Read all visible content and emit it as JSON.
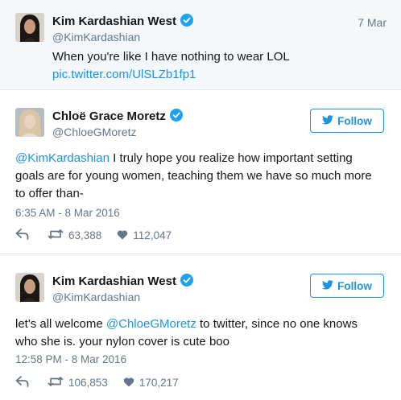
{
  "tweet1": {
    "name": "Kim Kardashian West",
    "handle": "@KimKardashian",
    "date": "7 Mar",
    "text": "When you're like I have nothing to wear LOL",
    "link": "pic.twitter.com/UlSLZb1fp1"
  },
  "tweet2": {
    "name": "Chloë Grace Moretz",
    "handle": "@ChloeGMoretz",
    "follow_label": "Follow",
    "mention": "@KimKardashian",
    "text_rest": " I truly hope you realize how important setting goals are for young women, teaching them we have so much more to offer than-",
    "timestamp": "6:35 AM - 8 Mar 2016",
    "retweets": "63,388",
    "likes": "112,047"
  },
  "tweet3": {
    "name": "Kim Kardashian West",
    "handle": "@KimKardashian",
    "follow_label": "Follow",
    "text_before": "let's all welcome ",
    "mention": "@ChloeGMoretz",
    "text_after": " to twitter, since no one knows who she is. your nylon cover is cute boo",
    "timestamp": "12:58 PM - 8 Mar 2016",
    "retweets": "106,853",
    "likes": "170,217"
  },
  "icons": {
    "verified": "verified-badge-icon",
    "twitter_bird": "twitter-bird-icon",
    "reply": "reply-icon",
    "retweet": "retweet-icon",
    "like": "heart-icon"
  },
  "colors": {
    "accent": "#1b95e0",
    "text": "#14171a",
    "muted": "#657786",
    "highlight_bg": "#f5f8fa"
  }
}
